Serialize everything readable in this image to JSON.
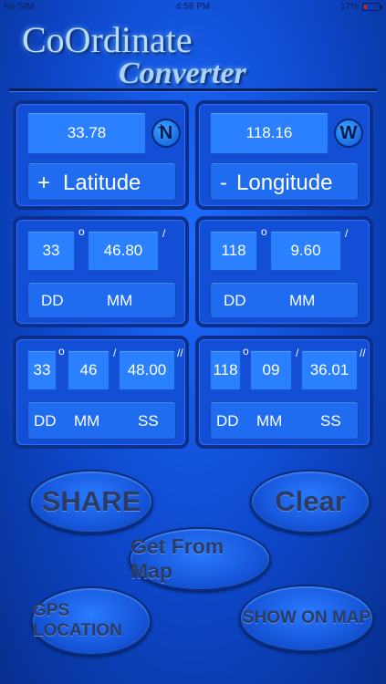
{
  "status_bar": {
    "carrier": "No SIM",
    "time": "4:58 PM",
    "battery": "17%"
  },
  "title": {
    "line1": "CoOrdinate",
    "line2": "Converter"
  },
  "latitude": {
    "decimal": "33.78",
    "hemisphere": "N",
    "hemisphere_sign": "+",
    "label_sign": "+",
    "label": "Latitude",
    "dm": {
      "dd": "33",
      "mm": "46.80",
      "dd_label": "DD",
      "mm_label": "MM"
    },
    "dms": {
      "dd": "33",
      "mm": "46",
      "ss": "48.00",
      "dd_label": "DD",
      "mm_label": "MM",
      "ss_label": "SS"
    }
  },
  "longitude": {
    "decimal": "118.16",
    "hemisphere": "W",
    "hemisphere_sign": "-",
    "label_sign": "-",
    "label": "Longitude",
    "dm": {
      "dd": "118",
      "mm": "9.60",
      "dd_label": "DD",
      "mm_label": "MM"
    },
    "dms": {
      "dd": "118",
      "mm": "09",
      "ss": "36.01",
      "dd_label": "DD",
      "mm_label": "MM",
      "ss_label": "SS"
    }
  },
  "symbols": {
    "degree": "o",
    "minute": "/",
    "second": "//"
  },
  "buttons": {
    "share": "SHARE",
    "clear": "Clear",
    "get_from_map": "Get From Map",
    "gps_location": "GPS LOCATION",
    "show_on_map": "SHOW ON MAP"
  }
}
